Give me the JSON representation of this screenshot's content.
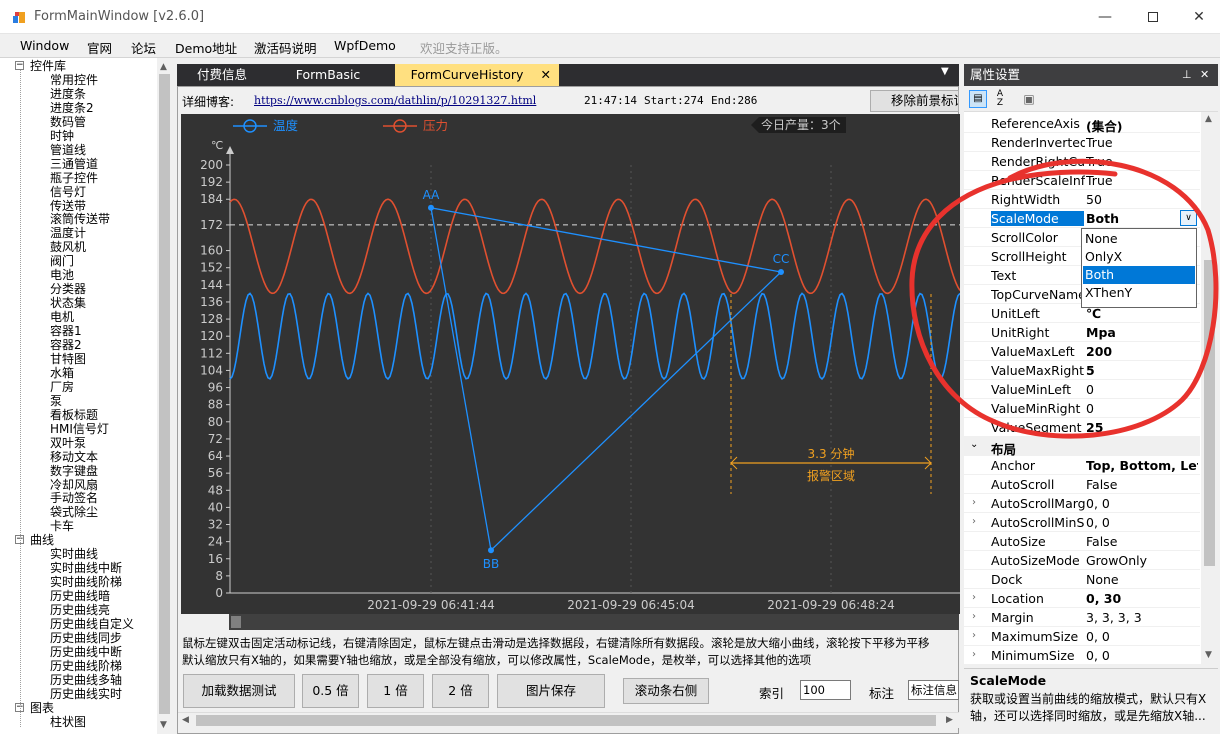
{
  "window": {
    "title": "FormMainWindow [v2.6.0]"
  },
  "menu": [
    "Window",
    "官网",
    "论坛",
    "Demo地址",
    "激活码说明",
    "WpfDemo",
    "欢迎支持正版。"
  ],
  "tree": {
    "root1": "控件库",
    "controls": [
      "常用控件",
      "进度条",
      "进度条2",
      "数码管",
      "时钟",
      "管道线",
      "三通管道",
      "瓶子控件",
      "信号灯",
      "传送带",
      "滚筒传送带",
      "温度计",
      "鼓风机",
      "阀门",
      "电池",
      "分类器",
      "状态集",
      "电机",
      "容器1",
      "容器2",
      "甘特图",
      "水箱",
      "厂房",
      "泵",
      "看板标题",
      "HMI信号灯",
      "双叶泵",
      "移动文本",
      "数字键盘",
      "冷却风扇",
      "手动签名",
      "袋式除尘",
      "卡车"
    ],
    "root2": "曲线",
    "curves": [
      "实时曲线",
      "实时曲线中断",
      "实时曲线阶梯",
      "历史曲线暗",
      "历史曲线亮",
      "历史曲线自定义",
      "历史曲线同步",
      "历史曲线中断",
      "历史曲线阶梯",
      "历史曲线多轴",
      "历史曲线实时"
    ],
    "root3": "图表",
    "charts": [
      "柱状图"
    ]
  },
  "tabs": [
    "付费信息",
    "FormBasic",
    "FormCurveHistory"
  ],
  "info": {
    "blog_label": "详细博客:",
    "blog_url": "https://www.cnblogs.com/dathlin/p/10291327.html",
    "time": "21:47:14",
    "start": "Start:274",
    "end": "End:286",
    "remove_button": "移除前景标记"
  },
  "chart_data": {
    "type": "line",
    "legend": [
      "温度",
      "压力"
    ],
    "legend_colors": [
      "#1e90ff",
      "#e05030"
    ],
    "badge": "今日产量：3个",
    "unit_left": "℃",
    "y_ticks": [
      0,
      8,
      16,
      24,
      32,
      40,
      48,
      56,
      64,
      72,
      80,
      88,
      96,
      104,
      112,
      120,
      128,
      136,
      144,
      152,
      160,
      172,
      184,
      192,
      200
    ],
    "ylim": [
      0,
      200
    ],
    "x_labels": [
      "2021-09-29 06:41:44",
      "2021-09-29 06:45:04",
      "2021-09-29 06:48:24"
    ],
    "reference_line": 172,
    "series": [
      {
        "name": "温度",
        "color": "#1e90ff",
        "min": 100,
        "max": 140,
        "cycles": 18.5
      },
      {
        "name": "压力",
        "color": "#e05030",
        "min": 140,
        "max": 184,
        "cycles": 9.5
      }
    ],
    "markers": [
      {
        "label": "AA",
        "value": 180
      },
      {
        "label": "BB",
        "value": 20
      },
      {
        "label": "CC",
        "value": 150
      }
    ],
    "alarm_zone": {
      "label": "报警区域",
      "duration": "3.3 分钟",
      "color": "#f0a020"
    }
  },
  "hint": {
    "line1": "鼠标左键双击固定活动标记线，右键清除固定，鼠标左键点击滑动是选择数据段，右键清除所有数据段。滚轮是放大缩小曲线，滚轮按下平移为平移",
    "line2": "默认缩放只有X轴的，如果需要Y轴也缩放，或是全部没有缩放，可以修改属性，ScaleMode，是枚举，可以选择其他的选项"
  },
  "buttons": {
    "load": "加载数据测试",
    "half": "0.5 倍",
    "one": "1 倍",
    "two": "2 倍",
    "save": "图片保存",
    "scroll_right": "滚动条右侧",
    "index_label": "索引",
    "index_value": "100",
    "mark_label": "标注",
    "mark_value": "标注信息"
  },
  "props": {
    "title": "属性设置",
    "rows1": [
      {
        "name": "ReferenceAxis",
        "value": "(集合)",
        "bold": true
      },
      {
        "name": "RenderInverted",
        "value": "True"
      },
      {
        "name": "RenderRightCurve",
        "value": "True"
      },
      {
        "name": "RenderScaleInfo",
        "value": "True"
      },
      {
        "name": "RightWidth",
        "value": "50"
      },
      {
        "name": "ScaleMode",
        "value": "Both",
        "bold": true,
        "selected": true
      },
      {
        "name": "ScrollColor",
        "value": ""
      },
      {
        "name": "ScrollHeight",
        "value": ""
      },
      {
        "name": "Text",
        "value": ""
      },
      {
        "name": "TopCurveName",
        "value": ""
      },
      {
        "name": "UnitLeft",
        "value": "℃",
        "bold": true
      },
      {
        "name": "UnitRight",
        "value": "Mpa",
        "bold": true
      },
      {
        "name": "ValueMaxLeft",
        "value": "200",
        "bold": true
      },
      {
        "name": "ValueMaxRight",
        "value": "5",
        "bold": true
      },
      {
        "name": "ValueMinLeft",
        "value": "0"
      },
      {
        "name": "ValueMinRight",
        "value": "0"
      },
      {
        "name": "ValueSegment",
        "value": "25",
        "bold": true
      }
    ],
    "category": "布局",
    "rows2": [
      {
        "name": "Anchor",
        "value": "Top, Bottom, Left,",
        "bold": true
      },
      {
        "name": "AutoScroll",
        "value": "False"
      },
      {
        "name": "AutoScrollMargin",
        "value": "0, 0",
        "exp": true
      },
      {
        "name": "AutoScrollMinSize",
        "value": "0, 0",
        "exp": true
      },
      {
        "name": "AutoSize",
        "value": "False"
      },
      {
        "name": "AutoSizeMode",
        "value": "GrowOnly"
      },
      {
        "name": "Dock",
        "value": "None"
      },
      {
        "name": "Location",
        "value": "0, 30",
        "bold": true,
        "exp": true
      },
      {
        "name": "Margin",
        "value": "3, 3, 3, 3",
        "exp": true
      },
      {
        "name": "MaximumSize",
        "value": "0, 0",
        "exp": true
      },
      {
        "name": "MinimumSize",
        "value": "0, 0",
        "exp": true
      }
    ],
    "dropdown": [
      "None",
      "OnlyX",
      "Both",
      "XThenY"
    ],
    "desc_title": "ScaleMode",
    "desc_text": "获取或设置当前曲线的缩放模式，默认只有X轴，还可以选择同时缩放，或是先缩放X轴..."
  }
}
